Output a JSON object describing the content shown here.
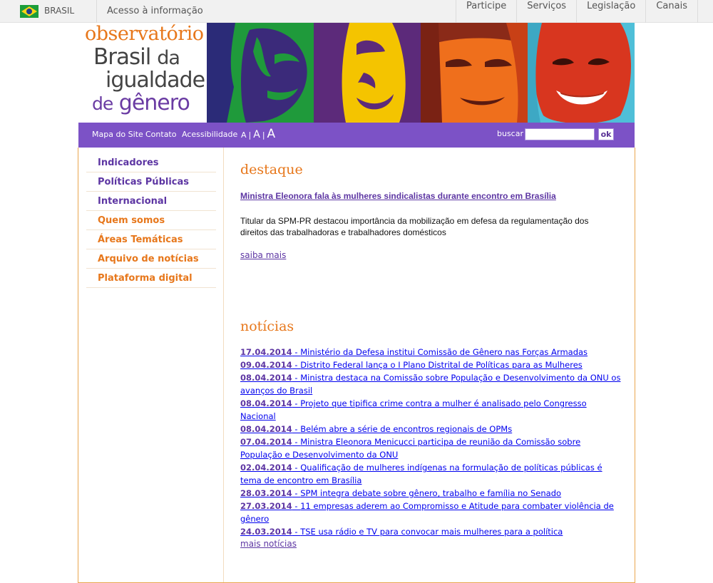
{
  "govbar": {
    "country": "BRASIL",
    "access_info": "Acesso à informação",
    "links": [
      "Participe",
      "Serviços",
      "Legislação",
      "Canais"
    ]
  },
  "logo": {
    "line1": "observatório",
    "line2_a": "Brasil",
    "line2_b": "da",
    "line3": "igualdade",
    "line4_a": "de",
    "line4_b": "gênero"
  },
  "topnav": {
    "links": [
      "Mapa do Site",
      "Contato",
      "Acessibilidade"
    ],
    "font_small": "A",
    "font_medium": "A",
    "font_large": "A",
    "font_sep": "|",
    "search_label": "buscar",
    "search_value": "",
    "ok_label": "ok"
  },
  "leftmenu": [
    {
      "label": "Indicadores",
      "color": "#5d36a3"
    },
    {
      "label": "Políticas Públicas",
      "color": "#5d36a3"
    },
    {
      "label": "Internacional",
      "color": "#5d36a3"
    },
    {
      "label": "Quem somos",
      "color": "#e7771b"
    },
    {
      "label": "Áreas Temáticas",
      "color": "#e7771b"
    },
    {
      "label": "Arquivo de notícias",
      "color": "#e7771b"
    },
    {
      "label": "Plataforma digital",
      "color": "#e7771b"
    }
  ],
  "destaque": {
    "title": "destaque",
    "headline": "Ministra Eleonora fala às mulheres sindicalistas durante encontro em Brasília",
    "text": "Titular da SPM-PR destacou importância da mobilização em defesa da regulamentação dos direitos das trabalhadoras e trabalhadores domésticos",
    "more": "saiba mais"
  },
  "noticias": {
    "title": "notícias",
    "items": [
      {
        "date": "17.04.2014",
        "text": "Ministério da Defesa institui Comissão de Gênero nas Forças Armadas"
      },
      {
        "date": "09.04.2014",
        "text": "Distrito Federal lança o I Plano Distrital de Políticas para as Mulheres"
      },
      {
        "date": "08.04.2014",
        "text": "Ministra destaca na Comissão sobre População e Desenvolvimento da ONU os avanços do Brasil"
      },
      {
        "date": "08.04.2014",
        "text": "Projeto que tipifica crime contra a mulher é analisado pelo Congresso Nacional"
      },
      {
        "date": "08.04.2014",
        "text": "Belém abre a série de encontros regionais de OPMs"
      },
      {
        "date": "07.04.2014",
        "text": "Ministra Eleonora Menicucci participa de reunião da Comissão sobre População e Desenvolvimento da ONU"
      },
      {
        "date": "02.04.2014",
        "text": "Qualificação de mulheres indígenas na formulação de políticas públicas é tema de encontro em Brasília"
      },
      {
        "date": "28.03.2014",
        "text": "SPM integra debate sobre gênero, trabalho e família no Senado"
      },
      {
        "date": "27.03.2014",
        "text": "11 empresas aderem ao Compromisso e Atitude para combater violência de gênero"
      },
      {
        "date": "24.03.2014",
        "text": "TSE usa rádio e TV para convocar mais mulheres para a política"
      }
    ],
    "separator": " - ",
    "more": "mais notícias"
  },
  "colors": {
    "purple_nav": "#7c52c6",
    "purple_text": "#5d36a3",
    "orange": "#e7771b",
    "frame_border": "#e9a64f"
  },
  "photos": [
    {
      "bg": "#1f9a3b",
      "face": "#3a2a78",
      "name": "green-photo"
    },
    {
      "bg": "#f4c400",
      "face": "#5a2a78",
      "name": "yellow-photo"
    },
    {
      "bg": "#ef6f1c",
      "face": "#8a2a1a",
      "name": "orange-photo"
    },
    {
      "bg": "#4fbfd8",
      "face": "#d8361f",
      "name": "cyan-photo"
    }
  ]
}
